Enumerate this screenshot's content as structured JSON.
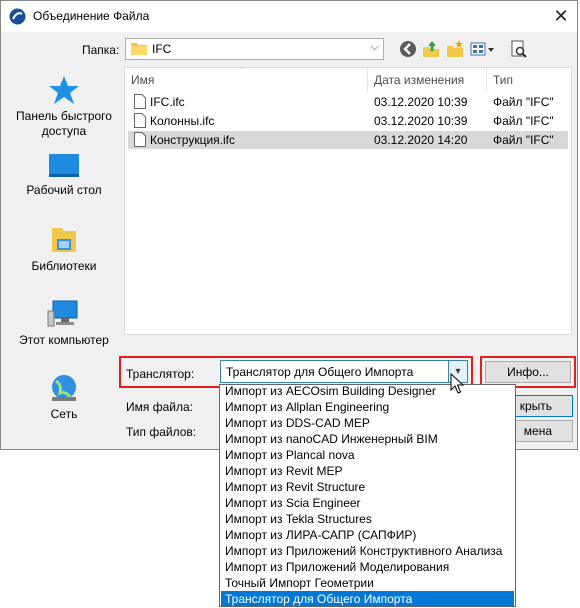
{
  "window": {
    "title": "Объединение Файла",
    "close_glyph": "✕"
  },
  "folder": {
    "label": "Папка:",
    "value": "IFC"
  },
  "toolbar": {
    "icons": [
      "back-icon",
      "up-folder-icon",
      "new-folder-icon",
      "view-menu-icon",
      "preview-icon"
    ]
  },
  "places": [
    {
      "label": "Панель быстрого доступа",
      "icon": "star-icon"
    },
    {
      "label": "Рабочий стол",
      "icon": "desktop-icon"
    },
    {
      "label": "Библиотеки",
      "icon": "libraries-icon"
    },
    {
      "label": "Этот компьютер",
      "icon": "computer-icon"
    },
    {
      "label": "Сеть",
      "icon": "network-icon"
    }
  ],
  "filelist": {
    "columns": [
      "Имя",
      "Дата изменения",
      "Тип"
    ],
    "rows": [
      {
        "name": "IFC.ifc",
        "date": "03.12.2020 10:39",
        "type": "Файл \"IFC\""
      },
      {
        "name": "Колонны.ifc",
        "date": "03.12.2020 10:39",
        "type": "Файл \"IFC\""
      },
      {
        "name": "Конструкция.ifc",
        "date": "03.12.2020 14:20",
        "type": "Файл \"IFC\"",
        "selected": true
      }
    ]
  },
  "translator": {
    "label": "Транслятор:",
    "value": "Транслятор для Общего Импорта",
    "info_button": "Инфо...",
    "options": [
      "Импорт из AECOsim Building Designer",
      "Импорт из Allplan Engineering",
      "Импорт из DDS-CAD MEP",
      "Импорт из nanoCAD Инженерный BIM",
      "Импорт из Plancal nova",
      "Импорт из Revit MEP",
      "Импорт из Revit Structure",
      "Импорт из Scia Engineer",
      "Импорт из Tekla Structures",
      "Импорт из ЛИРА-САПР (САПФИР)",
      "Импорт из Приложений Конструктивного Анализа",
      "Импорт из Приложений Моделирования",
      "Точный Импорт Геометрии",
      "Транслятор для Общего Импорта"
    ],
    "selected_index": 13
  },
  "filename": {
    "label": "Имя файла:"
  },
  "filetype": {
    "label": "Тип файлов:"
  },
  "buttons": {
    "open": "крыть",
    "cancel": "мена"
  },
  "colors": {
    "highlight": "#e02020",
    "selection": "#0078d7",
    "row_selected": "#d9d9d9"
  }
}
